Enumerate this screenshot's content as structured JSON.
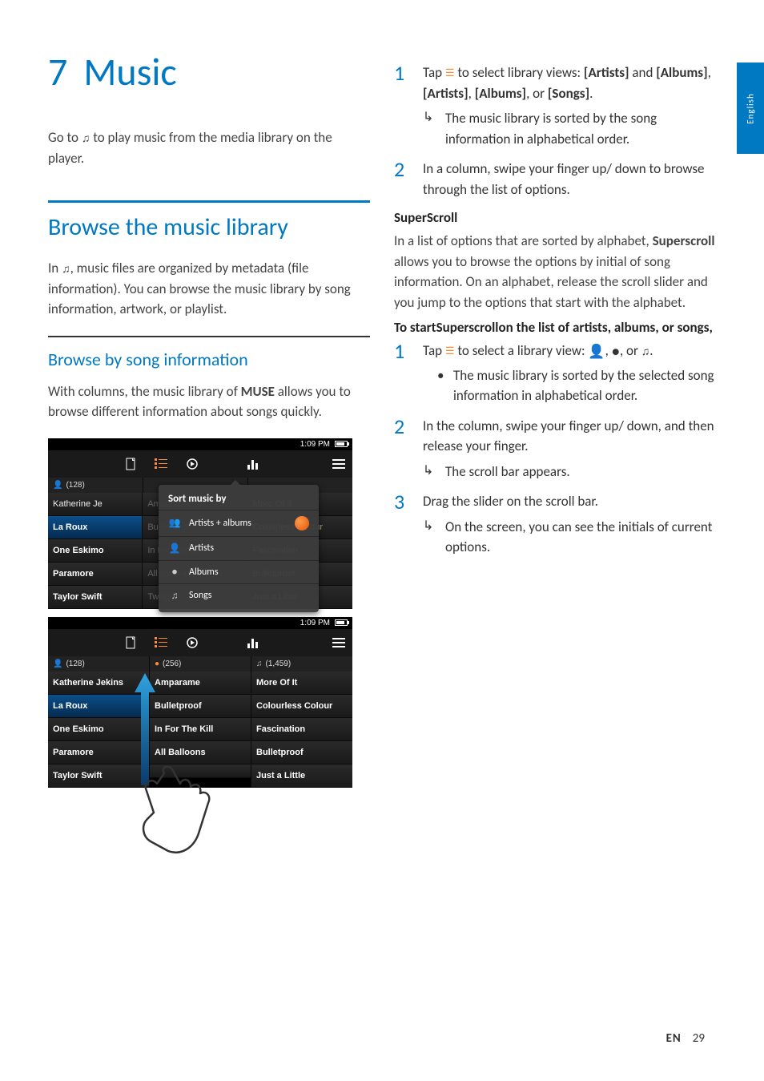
{
  "sideTab": "English",
  "chapter": {
    "num": "7",
    "title": "Music"
  },
  "intro_a": "Go to ",
  "intro_b": " to play music from the media library on the player.",
  "section1": {
    "heading": "Browse the music library",
    "text_a": "In ",
    "text_b": ", music files are organized by metadata (file information). You can browse the music library by song information, artwork, or playlist."
  },
  "subsection": {
    "heading": "Browse by song information",
    "text_a": "With columns, the music library of ",
    "muse": "MUSE",
    "text_b": " allows you to browse different information about songs quickly."
  },
  "screenshot1": {
    "time": "1:09 PM",
    "headers": {
      "artists": "(128)"
    },
    "col_artists": [
      "Katherine Je",
      "La Roux",
      "One Eskimo",
      "Paramore",
      "Taylor Swift"
    ],
    "col_albums_bg": [
      "Amparame",
      "Bulletproof",
      "In For The Kill",
      "All Balloons",
      "Twilight"
    ],
    "col_songs_bg": [
      "More Of It",
      "Colourless Colour",
      "Fascination",
      "Bulletproof",
      "Just a Little"
    ],
    "popup": {
      "title": "Sort music by",
      "items": [
        "Artists + albums",
        "Artists",
        "Albums",
        "Songs"
      ]
    }
  },
  "screenshot2": {
    "time": "1:09 PM",
    "headers": {
      "artists": "(128)",
      "albums": "(256)",
      "songs": "(1,459)"
    },
    "col_artists": [
      "Katherine Jekins",
      "La Roux",
      "One Eskimo",
      "Paramore",
      "Taylor Swift"
    ],
    "col_albums": [
      "Amparame",
      "Bulletproof",
      "In For The Kill",
      "All Balloons",
      ""
    ],
    "col_songs": [
      "More Of It",
      "Colourless Colour",
      "Fascination",
      "Bulletproof",
      "Just a Little"
    ]
  },
  "right": {
    "step1_a": "Tap ",
    "step1_b": " to select library views: ",
    "step1_opts": [
      "[Artists]",
      "[Albums]",
      "[Artists]",
      "[Albums]",
      "[Songs]"
    ],
    "step1_and": " and ",
    "step1_or": ", or ",
    "step1_period": ".",
    "step1_sub": "The music library is sorted by the song information in alphabetical order.",
    "step2": "In a column, swipe your finger up/ down to browse through the list of options.",
    "superscroll_h": "SuperScroll",
    "superscroll_p": "In a list of options that are sorted by alphabet, ",
    "superscroll_b": "Superscroll",
    "superscroll_p2": " allows you to browse the options by initial of song information. On an alphabet, release the scroll slider and you jump to the options that start with the alphabet.",
    "start_line": "To startSuperscrollon the list of artists, albums, or songs,",
    "s2_step1_a": "Tap ",
    "s2_step1_b": " to select a library view: ",
    "s2_step1_sub": "The music library is sorted by the selected song information in alphabetical order.",
    "s2_step2": "In the column, swipe your finger up/ down, and then release your finger.",
    "s2_step2_sub": "The scroll bar appears.",
    "s2_step3": "Drag the slider on the scroll bar.",
    "s2_step3_sub": "On the screen, you can see the initials of current options."
  },
  "footer": {
    "lang": "EN",
    "page": "29"
  },
  "sep_comma": ", ",
  "sep_comma_or": ", or ",
  "sep_period": "."
}
